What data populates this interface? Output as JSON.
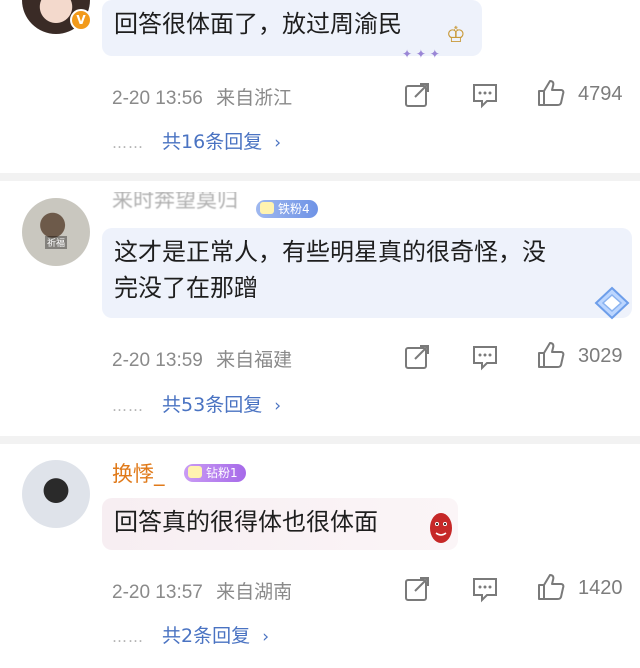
{
  "comments": [
    {
      "text": "回答很体面了，放过周渝民",
      "time": "2-20 13:56",
      "location": "来自浙江",
      "likes": "4794",
      "replies": "共16条回复",
      "badge": "V"
    },
    {
      "username": "来时奔望莫归",
      "fan_badge": "铁粉4",
      "avatar_tag": "祈福",
      "text_line1": "这才是正常人，有些明星真的很奇怪，没",
      "text_line2": "完没了在那蹭",
      "time": "2-20 13:59",
      "location": "来自福建",
      "likes": "3029",
      "replies": "共53条回复"
    },
    {
      "username": "换悸_",
      "fan_badge": "钻粉1",
      "text": "回答真的很得体也很体面",
      "time": "2-20 13:57",
      "location": "来自湖南",
      "likes": "1420",
      "replies": "共2条回复"
    }
  ],
  "ui": {
    "dots": "……",
    "chevron": "›"
  },
  "colors": {
    "link": "#4a73c2",
    "meta": "#8a8a8a",
    "username_orange": "#e07a1a",
    "divider": "#f2f2f2"
  }
}
